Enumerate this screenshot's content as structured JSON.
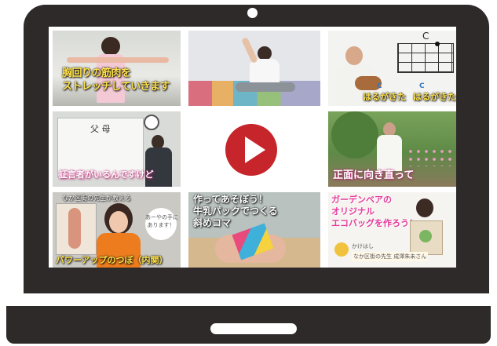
{
  "tiles": {
    "stretch_caption": "胸回りの筋肉を\nストレッチしていきます",
    "ukulele_chord": "C",
    "ukulele_lyric_1": "はるがきた",
    "ukulele_lyric_2": "はるがきた",
    "ukulele_chord_small_1": "C",
    "ukulele_chord_small_2": "C",
    "whiteboard_caption": "証言者がいるんですけど",
    "whiteboard_title": "父 母",
    "garden_caption": "正面に向き直って",
    "mask_header": "なか区街の先生が教える",
    "mask_caption": "パワーアップのつぼ（内関）",
    "mask_bubble": "あーやの手に\nあります！",
    "craft_caption": "作ってあそぼう！\n牛乳パックでつくる\n斜めコマ",
    "ecobag_caption": "ガーデンベアの\nオリジナル\nエコバッグを作ろう！",
    "ecobag_footer": "なか区街の先生 成澤朱未さん",
    "ecobag_org": "かけはし"
  },
  "colors": {
    "laptop": "#2f2a2a",
    "play": "#c6262b",
    "caption_yellow": "#ffe14b",
    "caption_pink": "#e53b9c"
  },
  "icons": {
    "play": "play-button-icon",
    "camera": "camera-icon"
  }
}
